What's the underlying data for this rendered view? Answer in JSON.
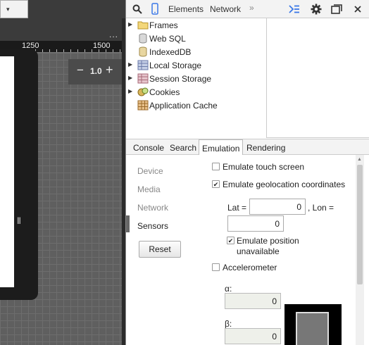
{
  "viewport": {
    "tab_glyph": "▾",
    "more_glyph": "...",
    "ruler_ticks": [
      "1250",
      "1500"
    ],
    "zoom": {
      "minus": "−",
      "value": "1.0",
      "plus": "+"
    },
    "drag_glyph": "|||"
  },
  "toolbar": {
    "tabs": [
      "Elements",
      "Network"
    ],
    "overflow": "»"
  },
  "resources": {
    "items": [
      {
        "label": "Frames",
        "expandable": true,
        "icon": "folder-icon"
      },
      {
        "label": "Web SQL",
        "expandable": false,
        "icon": "database-icon"
      },
      {
        "label": "IndexedDB",
        "expandable": false,
        "icon": "database-icon"
      },
      {
        "label": "Local Storage",
        "expandable": true,
        "icon": "storage-grid-icon"
      },
      {
        "label": "Session Storage",
        "expandable": true,
        "icon": "storage-grid-icon"
      },
      {
        "label": "Cookies",
        "expandable": true,
        "icon": "cookie-icon"
      },
      {
        "label": "Application Cache",
        "expandable": false,
        "icon": "cache-grid-icon"
      }
    ],
    "arrow_glyph": "▶"
  },
  "drawer": {
    "tabs": [
      "Console",
      "Search",
      "Emulation",
      "Rendering"
    ],
    "active_tab": "Emulation"
  },
  "emulation": {
    "sidebar": [
      "Device",
      "Media",
      "Network",
      "Sensors"
    ],
    "active_section": "Sensors",
    "reset_label": "Reset",
    "touch": {
      "label": "Emulate touch screen",
      "checked": false
    },
    "geolocation": {
      "label": "Emulate geolocation coordinates",
      "checked": true,
      "lat_label": "Lat =",
      "lat_value": "0",
      "lon_label": ", Lon =",
      "lon_value": "0",
      "unavailable_label_line1": "Emulate position",
      "unavailable_label_line2": "unavailable",
      "unavailable_checked": true
    },
    "accelerometer": {
      "label": "Accelerometer",
      "checked": false,
      "alpha_label": "α:",
      "alpha_value": "0",
      "beta_label": "β:",
      "beta_value": "0"
    },
    "check_glyph": "✔"
  },
  "colors": {
    "accent": "#3b78e7",
    "active_tab_bg": "#ffffff"
  }
}
